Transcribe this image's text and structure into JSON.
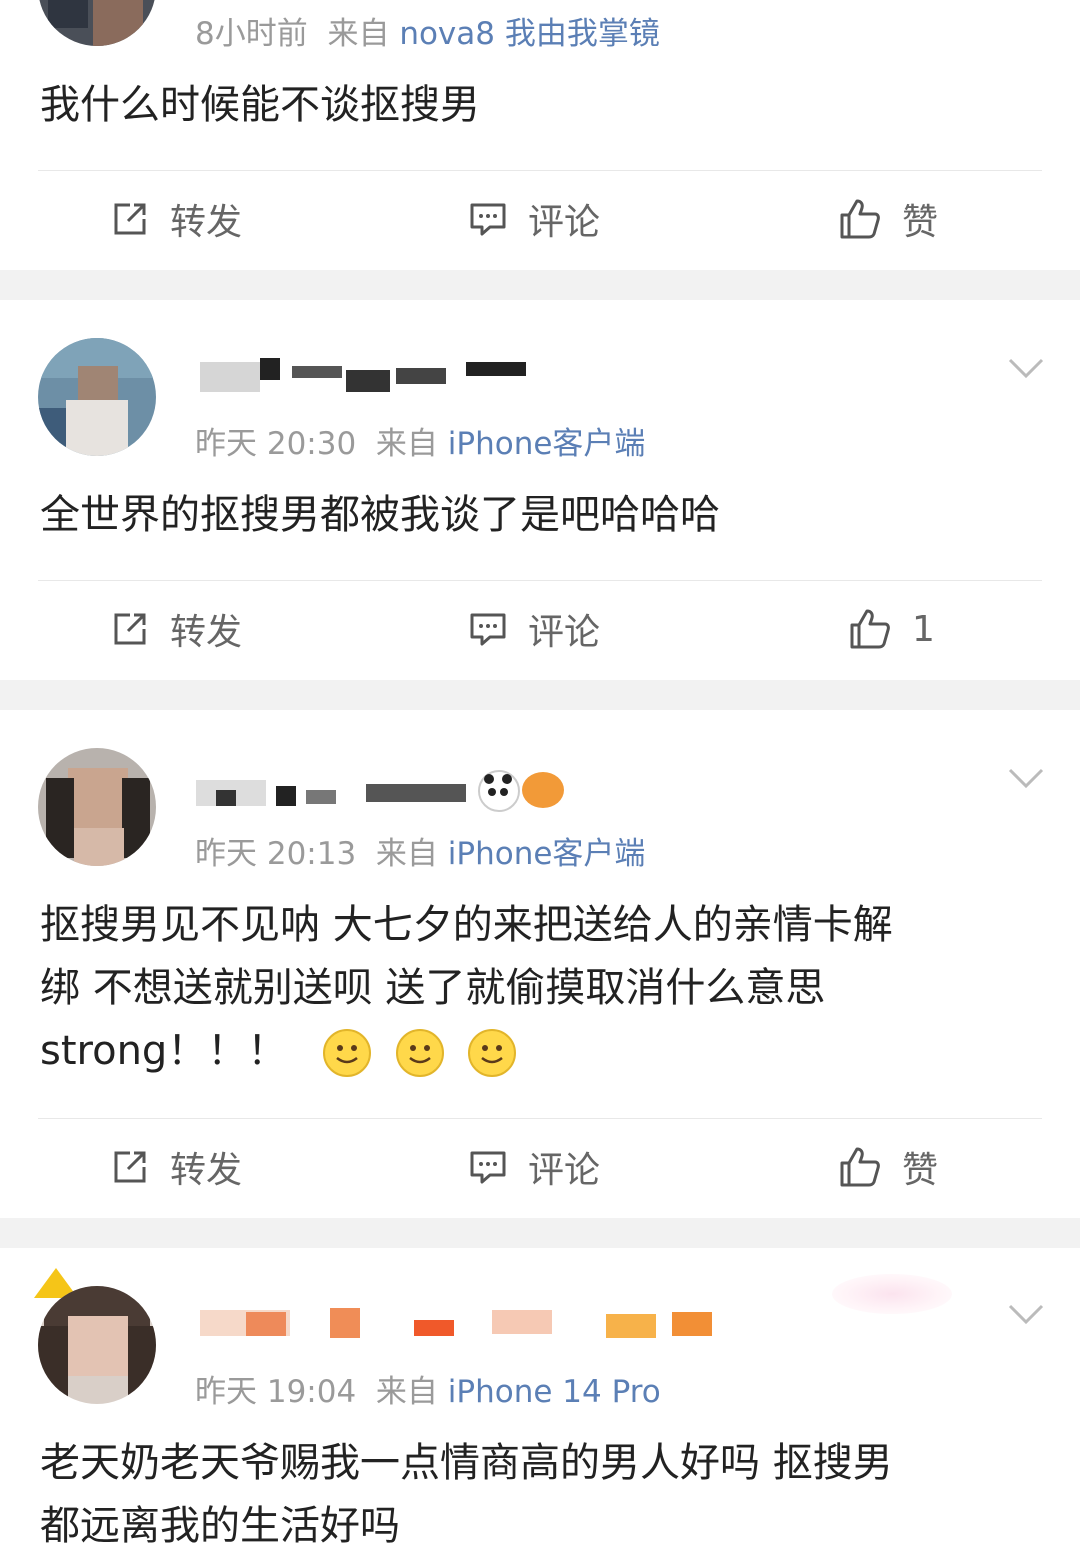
{
  "posts": [
    {
      "time": "8小时前",
      "source_prefix": "来自",
      "source": "nova8 我由我掌镜",
      "text": "我什么时候能不谈抠搜男",
      "actions": {
        "repost": "转发",
        "comment": "评论",
        "like": "赞"
      }
    },
    {
      "time": "昨天 20:30",
      "source_prefix": "来自",
      "source": "iPhone客户端",
      "text": "全世界的抠搜男都被我谈了是吧哈哈哈",
      "actions": {
        "repost": "转发",
        "comment": "评论",
        "like": "1"
      }
    },
    {
      "time": "昨天 20:13",
      "source_prefix": "来自",
      "source": "iPhone客户端",
      "text_line1": "抠搜男见不见呐 大七夕的来把送给人的亲情卡解",
      "text_line2": "绑 不想送就别送呗 送了就偷摸取消什么意思",
      "text_line3": "strong！！！",
      "actions": {
        "repost": "转发",
        "comment": "评论",
        "like": "赞"
      }
    },
    {
      "time": "昨天 19:04",
      "source_prefix": "来自",
      "source": "iPhone 14 Pro",
      "text_line1": "老天奶老天爷赐我一点情商高的男人好吗 抠搜男",
      "text_line2": "都远离我的生活好吗"
    }
  ],
  "colors": {
    "meta": "#9a9a9a",
    "source_link": "#5b7fb5",
    "separator": "#f2f2f2",
    "action_text": "#666666"
  },
  "icons": [
    "repost-icon",
    "comment-icon",
    "like-icon",
    "chevron-down-icon",
    "smile-emoji-icon"
  ]
}
